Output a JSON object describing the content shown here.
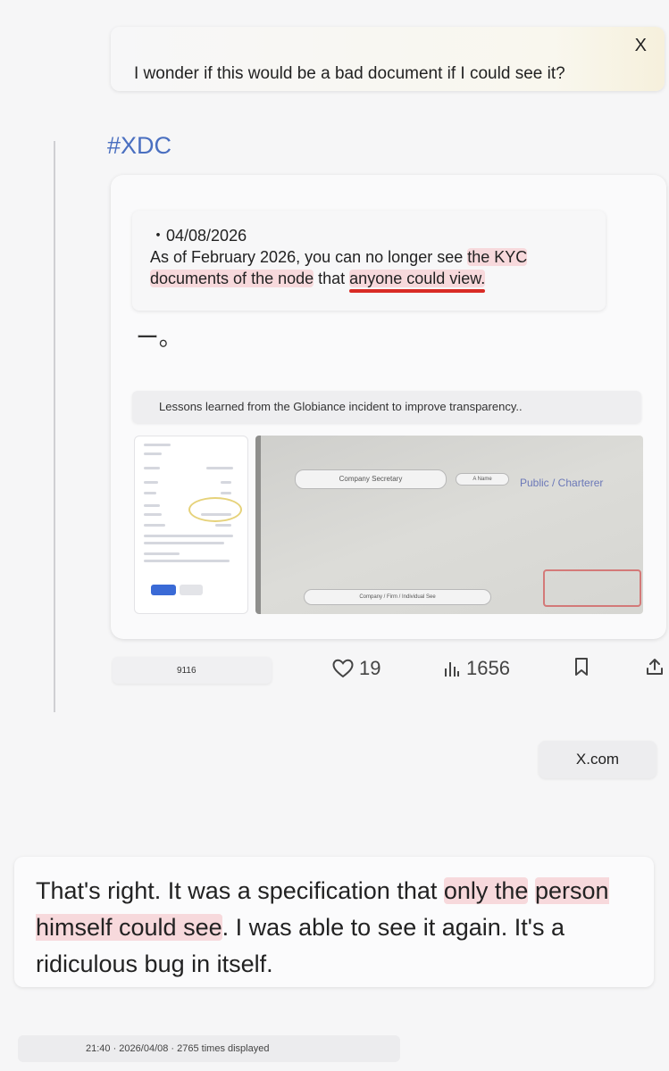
{
  "banner": {
    "close_label": "X",
    "message": "I wonder if this would be a bad document if I could see it?"
  },
  "post": {
    "hashtag": "#XDC",
    "quote": {
      "date": "・04/08/2026",
      "line1_plain": "As of February 2026, you can no longer see ",
      "line1_highlight": "the KYC",
      "line2_highlight": "documents of the node",
      "line2_plain": " that ",
      "line2_underlined": "anyone could view."
    },
    "mark": "ー。",
    "caption": "Lessons learned from the Globiance incident to improve transparency..",
    "screenshot": {
      "chip_company_secretary": "Company Secretary",
      "chip_small": "A Name",
      "public_text": "Public / Charterer",
      "chip_bottom": "Company / Firm / Individual See"
    }
  },
  "actions": {
    "views_chip": "9116",
    "likes": "19",
    "views": "1656",
    "heart_icon": "heart-icon",
    "chart_icon": "bar-chart-icon",
    "bookmark_icon": "bookmark-icon",
    "share_icon": "share-icon"
  },
  "source_label": "X.com",
  "reply": {
    "p1": "That's right. It was a specification that ",
    "h1": "only the",
    "h2": "person himself could see",
    "p2": ". I was able to see it again. It's ",
    "u1": "a ridiculous bug",
    "p3": " in itself."
  },
  "footer": "21:40 · 2026/04/08 · 2765 times displayed",
  "colors": {
    "accent_link": "#4a6fc0",
    "highlight": "#f7d9dc",
    "underline_red": "#d92b25"
  }
}
